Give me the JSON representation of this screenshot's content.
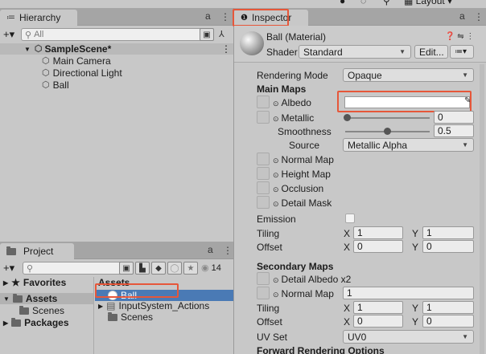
{
  "hierarchy": {
    "tab_label": "Hierarchy",
    "search_placeholder": "All",
    "scene_name": "SampleScene*",
    "objects": [
      "Main Camera",
      "Directional Light",
      "Ball"
    ]
  },
  "inspector": {
    "tab_label": "Inspector",
    "material_name": "Ball (Material)",
    "shader_label": "Shader",
    "shader_value": "Standard",
    "edit_button": "Edit...",
    "rendering_mode_label": "Rendering Mode",
    "rendering_mode_value": "Opaque",
    "main_maps_header": "Main Maps",
    "albedo_label": "Albedo",
    "metallic_label": "Metallic",
    "metallic_value": "0",
    "metallic_level": 0.0,
    "smoothness_label": "Smoothness",
    "smoothness_value": "0.5",
    "smoothness_level": 0.5,
    "source_label": "Source",
    "source_value": "Metallic Alpha",
    "normal_map_label": "Normal Map",
    "height_map_label": "Height Map",
    "occlusion_label": "Occlusion",
    "detail_mask_label": "Detail Mask",
    "emission_label": "Emission",
    "tiling_label": "Tiling",
    "offset_label": "Offset",
    "x_label": "X",
    "y_label": "Y",
    "main_tiling": {
      "x": "1",
      "y": "1"
    },
    "main_offset": {
      "x": "0",
      "y": "0"
    },
    "secondary_maps_header": "Secondary Maps",
    "detail_albedo_label": "Detail Albedo x2",
    "secondary_normal_label": "Normal Map",
    "secondary_normal_value": "1",
    "secondary_tiling": {
      "x": "1",
      "y": "1"
    },
    "secondary_offset": {
      "x": "0",
      "y": "0"
    },
    "uv_set_label": "UV Set",
    "uv_set_value": "UV0",
    "forward_rendering_header": "Forward Rendering Options"
  },
  "project": {
    "tab_label": "Project",
    "search_placeholder": "",
    "hidden_count": "14",
    "sidebar": {
      "favorites": "Favorites",
      "assets": "Assets",
      "scenes": "Scenes",
      "packages": "Packages"
    },
    "breadcrumb": "Assets",
    "files": [
      "Ball",
      "InputSystem_Actions",
      "Scenes"
    ]
  },
  "toolbar": {
    "layout_label": "Layout"
  },
  "colors": {
    "highlight": "#e6573a",
    "selection": "#4a7ab5"
  }
}
